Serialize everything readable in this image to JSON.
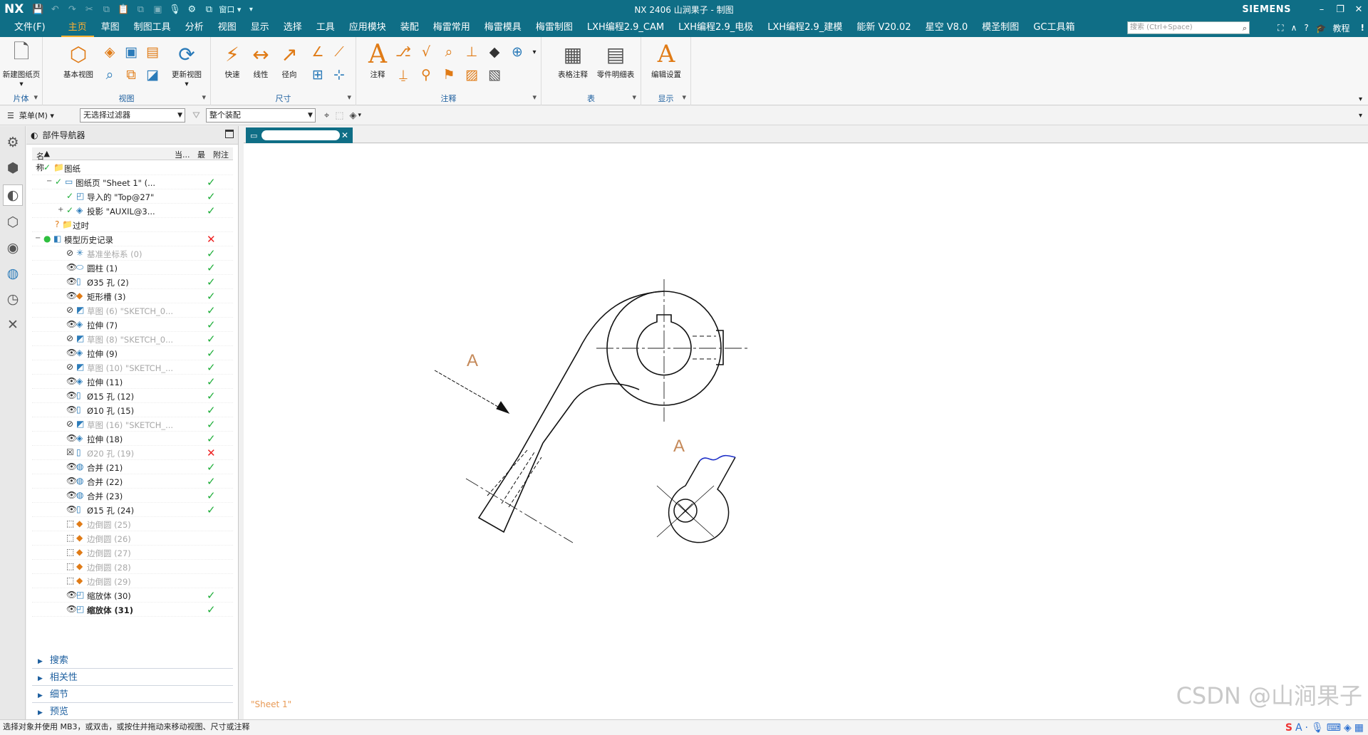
{
  "titlebar": {
    "logo": "NX",
    "window_menu": "窗口",
    "title": "NX 2406 山涧果子 - 制图",
    "brand": "SIEMENS",
    "win_min": "–",
    "win_restore": "❐",
    "win_close": "✕"
  },
  "menu": {
    "file": "文件(F)",
    "tabs": [
      "主页",
      "草图",
      "制图工具",
      "分析",
      "视图",
      "显示",
      "选择",
      "工具",
      "应用模块",
      "装配",
      "梅雷常用",
      "梅雷模具",
      "梅雷制图",
      "LXH编程2.9_CAM",
      "LXH编程2.9_电极",
      "LXH编程2.9_建模",
      "能新 V20.02",
      "星空 V8.0",
      "模圣制图",
      "GC工具箱"
    ],
    "active_tab": "主页",
    "search_placeholder": "搜索 (Ctrl+Space)",
    "tutorial": "教程"
  },
  "ribbon": {
    "groups": {
      "sheet": "片体",
      "view": "视图",
      "dimension": "尺寸",
      "annotation": "注释",
      "table": "表",
      "display": "显示"
    },
    "buttons": {
      "new_sheet": "新建图纸页",
      "base_view": "基本视图",
      "update_view": "更新视图",
      "rapid": "快速",
      "linear": "线性",
      "radial": "径向",
      "note": "注释",
      "table_note": "表格注释",
      "parts_list": "零件明细表",
      "edit_settings": "编辑设置"
    }
  },
  "selbar": {
    "menu_label": "菜单(M)",
    "filter_value": "无选择过滤器",
    "scope_value": "整个装配"
  },
  "navigator": {
    "title": "部件导航器",
    "columns": {
      "name": "名称",
      "current": "当...",
      "latest": "最",
      "note": "附注"
    },
    "rows": [
      {
        "name": "图纸",
        "indent": 0,
        "toggle": "−",
        "icon": "📁",
        "check": true
      },
      {
        "name": "图纸页 \"Sheet 1\" (...",
        "indent": 1,
        "toggle": "−",
        "icon": "▭",
        "check": true,
        "latest": "✓"
      },
      {
        "name": "导入的 \"Top@27\"",
        "indent": 2,
        "icon": "◰",
        "check": true,
        "latest": "✓"
      },
      {
        "name": "投影 \"AUXIL@3...",
        "indent": 2,
        "toggle": "+",
        "icon": "◈",
        "check": true,
        "latest": "✓"
      },
      {
        "name": "过时",
        "indent": 1,
        "icon": "📁",
        "q": true
      },
      {
        "name": "模型历史记录",
        "indent": 0,
        "toggle": "−",
        "icon": "◧",
        "dot": true,
        "latest": "✕"
      },
      {
        "name": "基准坐标系 (0)",
        "indent": 2,
        "eye": "⊘",
        "icon": "✳",
        "dim": true,
        "latest": "✓"
      },
      {
        "name": "圆柱 (1)",
        "indent": 2,
        "eye": "👁",
        "icon": "⬭",
        "latest": "✓"
      },
      {
        "name": "Ø35 孔 (2)",
        "indent": 2,
        "eye": "👁",
        "icon": "▯",
        "latest": "✓"
      },
      {
        "name": "矩形槽 (3)",
        "indent": 2,
        "eye": "👁",
        "icon": "◆",
        "latest": "✓"
      },
      {
        "name": "草图 (6) \"SKETCH_0...",
        "indent": 2,
        "eye": "⊘",
        "icon": "◩",
        "dim": true,
        "latest": "✓"
      },
      {
        "name": "拉伸 (7)",
        "indent": 2,
        "eye": "👁",
        "icon": "◈",
        "latest": "✓"
      },
      {
        "name": "草图 (8) \"SKETCH_0...",
        "indent": 2,
        "eye": "⊘",
        "icon": "◩",
        "dim": true,
        "latest": "✓"
      },
      {
        "name": "拉伸 (9)",
        "indent": 2,
        "eye": "👁",
        "icon": "◈",
        "latest": "✓"
      },
      {
        "name": "草图 (10) \"SKETCH_...",
        "indent": 2,
        "eye": "⊘",
        "icon": "◩",
        "dim": true,
        "latest": "✓"
      },
      {
        "name": "拉伸 (11)",
        "indent": 2,
        "eye": "👁",
        "icon": "◈",
        "latest": "✓"
      },
      {
        "name": "Ø15 孔 (12)",
        "indent": 2,
        "eye": "👁",
        "icon": "▯",
        "latest": "✓"
      },
      {
        "name": "Ø10 孔 (15)",
        "indent": 2,
        "eye": "👁",
        "icon": "▯",
        "latest": "✓"
      },
      {
        "name": "草图 (16) \"SKETCH_...",
        "indent": 2,
        "eye": "⊘",
        "icon": "◩",
        "dim": true,
        "latest": "✓"
      },
      {
        "name": "拉伸 (18)",
        "indent": 2,
        "eye": "👁",
        "icon": "◈",
        "latest": "✓"
      },
      {
        "name": "Ø20 孔 (19)",
        "indent": 2,
        "eye": "☒",
        "icon": "▯",
        "dim": true,
        "latest": "✕"
      },
      {
        "name": "合并 (21)",
        "indent": 2,
        "eye": "👁",
        "icon": "◍",
        "latest": "✓"
      },
      {
        "name": "合并 (22)",
        "indent": 2,
        "eye": "👁",
        "icon": "◍",
        "latest": "✓"
      },
      {
        "name": "合并 (23)",
        "indent": 2,
        "eye": "👁",
        "icon": "◍",
        "latest": "✓"
      },
      {
        "name": "Ø15 孔 (24)",
        "indent": 2,
        "eye": "👁",
        "icon": "▯",
        "latest": "✓"
      },
      {
        "name": "边倒圆 (25)",
        "indent": 2,
        "eye": "⬚",
        "icon": "◆",
        "dim": true
      },
      {
        "name": "边倒圆 (26)",
        "indent": 2,
        "eye": "⬚",
        "icon": "◆",
        "dim": true
      },
      {
        "name": "边倒圆 (27)",
        "indent": 2,
        "eye": "⬚",
        "icon": "◆",
        "dim": true
      },
      {
        "name": "边倒圆 (28)",
        "indent": 2,
        "eye": "⬚",
        "icon": "◆",
        "dim": true
      },
      {
        "name": "边倒圆 (29)",
        "indent": 2,
        "eye": "⬚",
        "icon": "◆",
        "dim": true
      },
      {
        "name": "缩放体 (30)",
        "indent": 2,
        "eye": "👁",
        "icon": "◰",
        "latest": "✓"
      },
      {
        "name": "缩放体 (31)",
        "indent": 2,
        "eye": "👁",
        "icon": "◰",
        "bold": true,
        "latest": "✓"
      }
    ],
    "sections": [
      "搜索",
      "相关性",
      "细节",
      "预览"
    ]
  },
  "drawing": {
    "view_label_a1": "A",
    "view_label_a2": "A",
    "sheet_label": "\"Sheet 1\"",
    "watermark": "CSDN @山涧果子"
  },
  "status": {
    "message": "选择对象并使用 MB3，或双击，或按住并拖动来移动视图、尺寸或注释"
  }
}
